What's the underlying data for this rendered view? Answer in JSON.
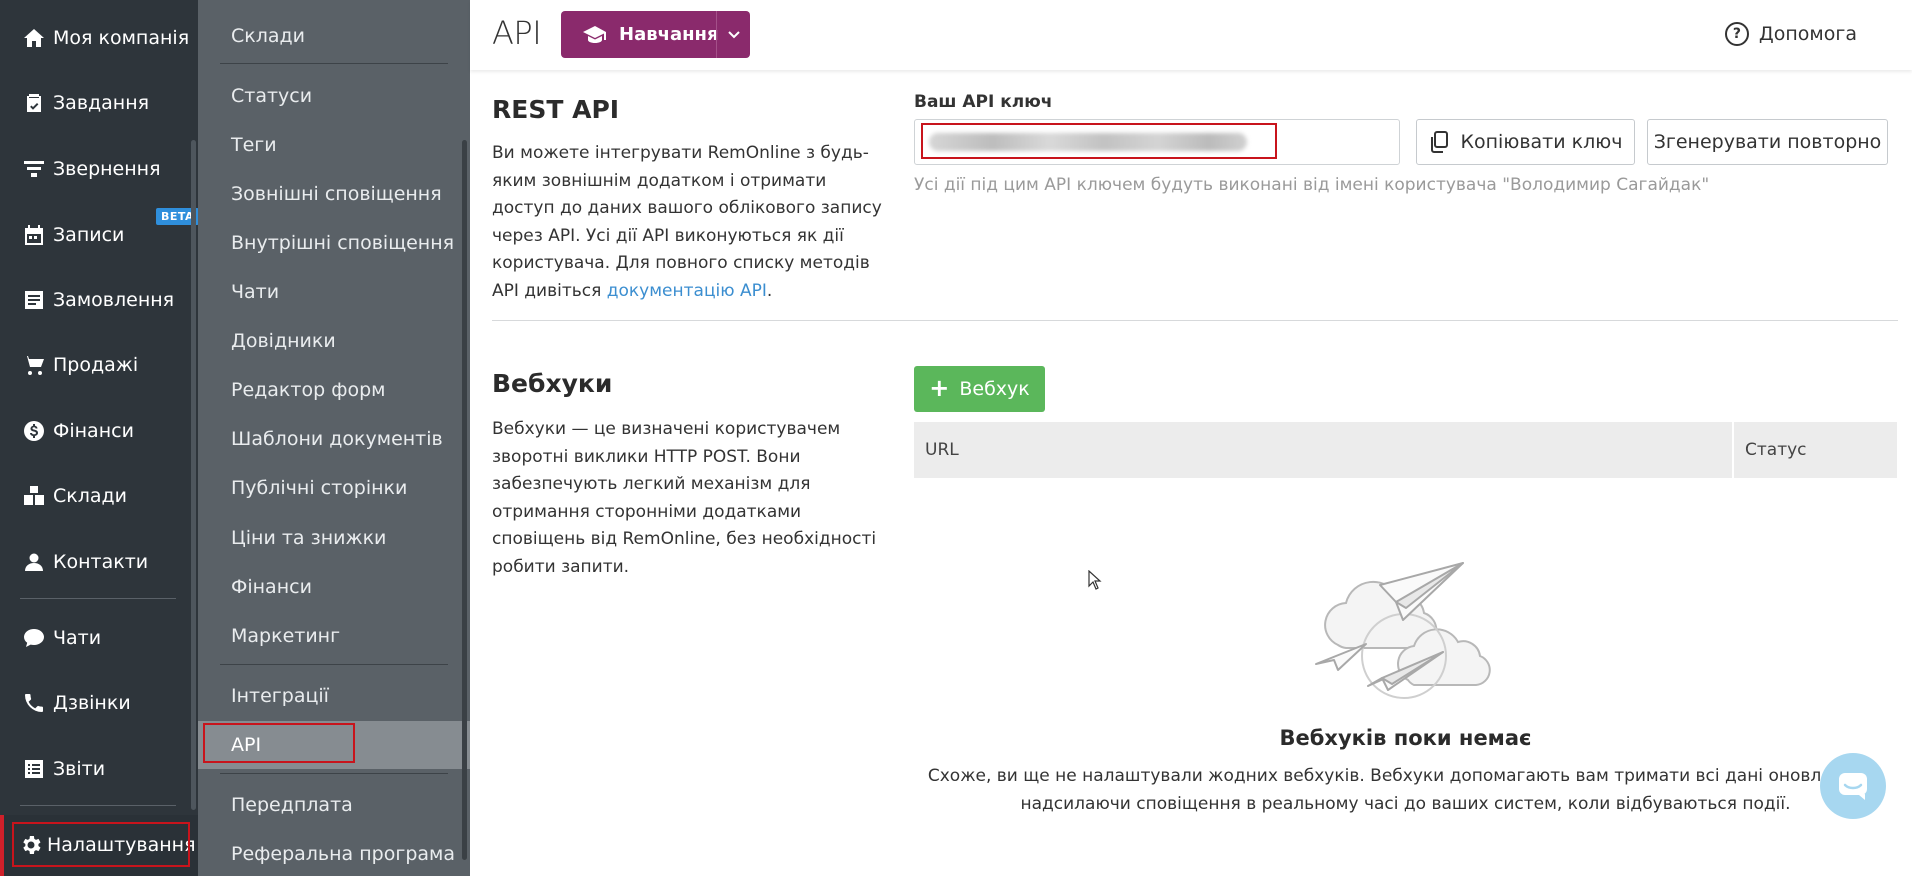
{
  "primary_nav": {
    "items": [
      {
        "label": "Моя компанія",
        "icon": "home-icon"
      },
      {
        "label": "Завдання",
        "icon": "task-icon"
      },
      {
        "label": "Звернення",
        "icon": "funnel-icon"
      },
      {
        "label": "Записи",
        "icon": "calendar-icon",
        "badge": "BETA"
      },
      {
        "label": "Замовлення",
        "icon": "orders-icon"
      },
      {
        "label": "Продажі",
        "icon": "cart-icon"
      },
      {
        "label": "Фінанси",
        "icon": "dollar-icon"
      },
      {
        "label": "Склади",
        "icon": "warehouse-icon"
      },
      {
        "label": "Контакти",
        "icon": "contacts-icon"
      },
      {
        "label": "Чати",
        "icon": "chat-icon"
      },
      {
        "label": "Дзвінки",
        "icon": "phone-icon"
      },
      {
        "label": "Звіти",
        "icon": "reports-icon"
      },
      {
        "label": "Налаштування",
        "icon": "gear-icon",
        "active": true
      }
    ]
  },
  "settings_nav": {
    "items": [
      "Склади",
      "Статуси",
      "Теги",
      "Зовнішні сповіщення",
      "Внутрішні сповіщення",
      "Чати",
      "Довідники",
      "Редактор форм",
      "Шаблони документів",
      "Публічні сторінки",
      "Ціни та знижки",
      "Фінанси",
      "Маркетинг",
      "Інтеграції",
      "API",
      "Передплата",
      "Реферальна програма"
    ],
    "active": "API"
  },
  "header": {
    "title": "API",
    "learn_button": "Навчання",
    "help_label": "Допомога",
    "brand_color": "#8a2a6c"
  },
  "rest_api": {
    "title": "REST API",
    "description_1": "Ви можете інтегрувати RemOnline з будь-яким зовнішнім додатком і отримати доступ до даних вашого облікового запису через API. Усі дії API виконуються як дії користувача. Для повного списку методів API дивіться ",
    "doc_link": "документацію API",
    "description_2": ".",
    "key_label": "Ваш API ключ",
    "copy_button": "Копіювати ключ",
    "regenerate_button": "Згенерувати повторно",
    "hint": "Усі дії під цим API ключем будуть виконані від імені користувача \"Володимир Сагайдак\""
  },
  "webhooks": {
    "title": "Вебхуки",
    "description": "Вебхуки — це визначені користувачем зворотні виклики HTTP POST. Вони забезпечують легкий механізм для отримання сторонніми додатками сповіщень від RemOnline, без необхідності робити запити.",
    "add_button": "Вебхук",
    "columns": [
      "URL",
      "Статус"
    ],
    "empty_title": "Вебхуків поки немає",
    "empty_text": "Схоже, ви ще не налаштували жодних вебхуків. Вебхуки допомагають вам тримати всі дані оновленими, надсилаючи сповіщення в реальному часі до ваших систем, коли відбуваються події.",
    "add_color": "#5bb75b"
  }
}
